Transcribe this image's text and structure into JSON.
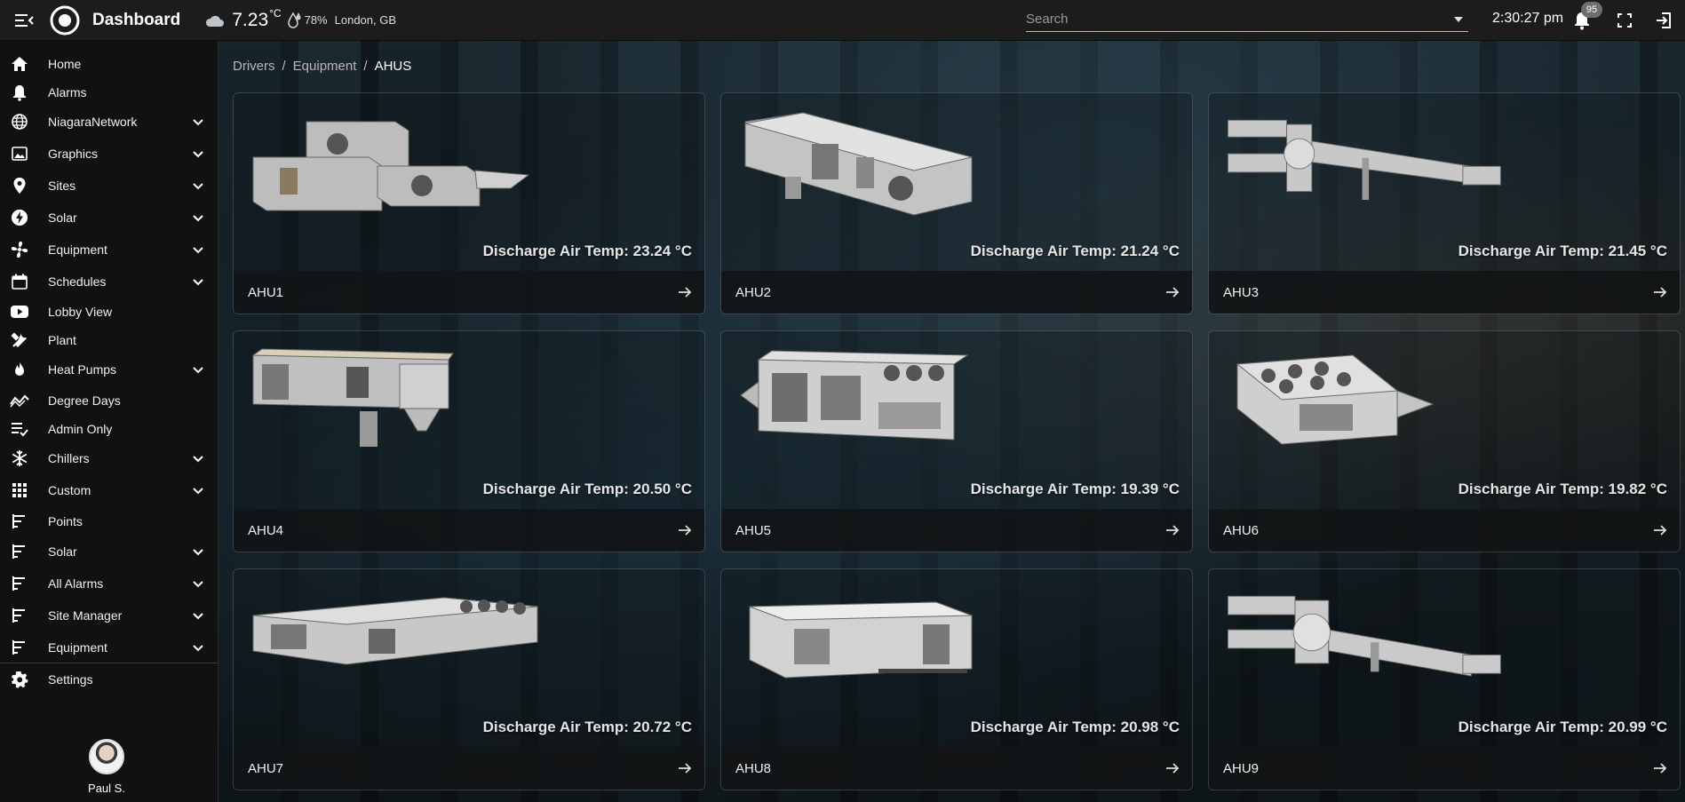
{
  "header": {
    "title": "Dashboard",
    "weather": {
      "temperature": "7.23",
      "unit": "°C",
      "humidity": "78%",
      "location": "London, GB",
      "icon": "cloud-icon"
    },
    "search": {
      "placeholder": "Search",
      "value": ""
    },
    "time": "2:30:27 pm",
    "notifications_count": "95"
  },
  "sidebar": {
    "items": [
      {
        "label": "Home",
        "icon": "home-icon",
        "expandable": false
      },
      {
        "label": "Alarms",
        "icon": "bell-icon",
        "expandable": false
      },
      {
        "label": "NiagaraNetwork",
        "icon": "globe-icon",
        "expandable": true
      },
      {
        "label": "Graphics",
        "icon": "image-icon",
        "expandable": true
      },
      {
        "label": "Sites",
        "icon": "map-pin-icon",
        "expandable": true
      },
      {
        "label": "Solar",
        "icon": "bolt-icon",
        "expandable": true
      },
      {
        "label": "Equipment",
        "icon": "fan-icon",
        "expandable": true
      },
      {
        "label": "Schedules",
        "icon": "calendar-icon",
        "expandable": true
      },
      {
        "label": "Lobby View",
        "icon": "video-icon",
        "expandable": false
      },
      {
        "label": "Plant",
        "icon": "tools-icon",
        "expandable": false
      },
      {
        "label": "Heat Pumps",
        "icon": "flame-icon",
        "expandable": true
      },
      {
        "label": "Degree Days",
        "icon": "trend-icon",
        "expandable": false
      },
      {
        "label": "Admin Only",
        "icon": "checklist-icon",
        "expandable": false
      },
      {
        "label": "Chillers",
        "icon": "snowflake-icon",
        "expandable": true
      },
      {
        "label": "Custom",
        "icon": "grid-icon",
        "expandable": true
      },
      {
        "label": "Points",
        "icon": "bars-icon",
        "expandable": false
      },
      {
        "label": "Solar",
        "icon": "bars-icon",
        "expandable": true
      },
      {
        "label": "All Alarms",
        "icon": "bars-icon",
        "expandable": true
      },
      {
        "label": "Site Manager",
        "icon": "bars-icon",
        "expandable": true
      },
      {
        "label": "Equipment",
        "icon": "bars-icon",
        "expandable": true
      },
      {
        "label": "Settings",
        "icon": "gear-icon",
        "expandable": false
      }
    ],
    "user": {
      "name": "Paul S."
    }
  },
  "breadcrumb": [
    "Drivers",
    "Equipment",
    "AHUS"
  ],
  "cards": [
    {
      "name": "AHU1",
      "temp_label": "Discharge Air Temp: 23.24 °C"
    },
    {
      "name": "AHU2",
      "temp_label": "Discharge Air Temp: 21.24 °C"
    },
    {
      "name": "AHU3",
      "temp_label": "Discharge Air Temp: 21.45 °C"
    },
    {
      "name": "AHU4",
      "temp_label": "Discharge Air Temp: 20.50 °C"
    },
    {
      "name": "AHU5",
      "temp_label": "Discharge Air Temp: 19.39 °C"
    },
    {
      "name": "AHU6",
      "temp_label": "Discharge Air Temp: 19.82 °C"
    },
    {
      "name": "AHU7",
      "temp_label": "Discharge Air Temp: 20.72 °C"
    },
    {
      "name": "AHU8",
      "temp_label": "Discharge Air Temp: 20.98 °C"
    },
    {
      "name": "AHU9",
      "temp_label": "Discharge Air Temp: 20.99 °C"
    }
  ],
  "colors": {
    "topbar": "#1c1c1c",
    "sidebar": "#111111",
    "badge": "#6e6e6e",
    "card_footer": "#121416"
  }
}
